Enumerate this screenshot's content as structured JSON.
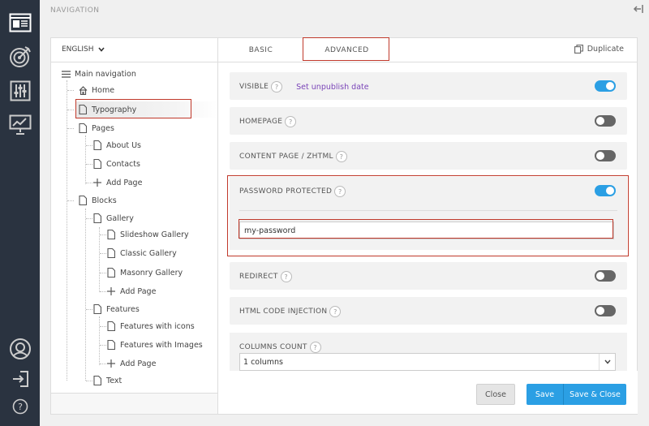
{
  "topbar": {
    "title": "NAVIGATION"
  },
  "tree": {
    "language": "ENGLISH",
    "items": [
      {
        "label": "Main navigation"
      },
      {
        "label": "Home"
      },
      {
        "label": "Typography"
      },
      {
        "label": "Pages"
      },
      {
        "label": "About Us"
      },
      {
        "label": "Contacts"
      },
      {
        "label": "Add Page"
      },
      {
        "label": "Blocks"
      },
      {
        "label": "Gallery"
      },
      {
        "label": "Slideshow Gallery"
      },
      {
        "label": "Classic Gallery"
      },
      {
        "label": "Masonry Gallery"
      },
      {
        "label": "Add Page"
      },
      {
        "label": "Features"
      },
      {
        "label": "Features with icons"
      },
      {
        "label": "Features with Images"
      },
      {
        "label": "Add Page"
      },
      {
        "label": "Text"
      }
    ]
  },
  "tabs": {
    "basic": "BASIC",
    "advanced": "ADVANCED",
    "duplicate": "Duplicate"
  },
  "settings": {
    "visible": {
      "label": "VISIBLE",
      "link": "Set unpublish date",
      "on": true
    },
    "homepage": {
      "label": "HOMEPAGE",
      "on": false
    },
    "content_page": {
      "label": "CONTENT PAGE / ZHTML",
      "on": false
    },
    "password": {
      "label": "PASSWORD PROTECTED",
      "on": true,
      "value": "my-password"
    },
    "redirect": {
      "label": "REDIRECT",
      "on": false
    },
    "html_injection": {
      "label": "HTML CODE INJECTION",
      "on": false
    },
    "columns": {
      "label": "COLUMNS COUNT",
      "selected": "1 columns"
    },
    "help_glyph": "?"
  },
  "footer": {
    "close": "Close",
    "save": "Save",
    "save_close": "Save & Close"
  },
  "colors": {
    "rail": "#2a3340",
    "accent": "#2b9fe4",
    "link": "#7a44b8",
    "highlight": "#c0392b"
  }
}
